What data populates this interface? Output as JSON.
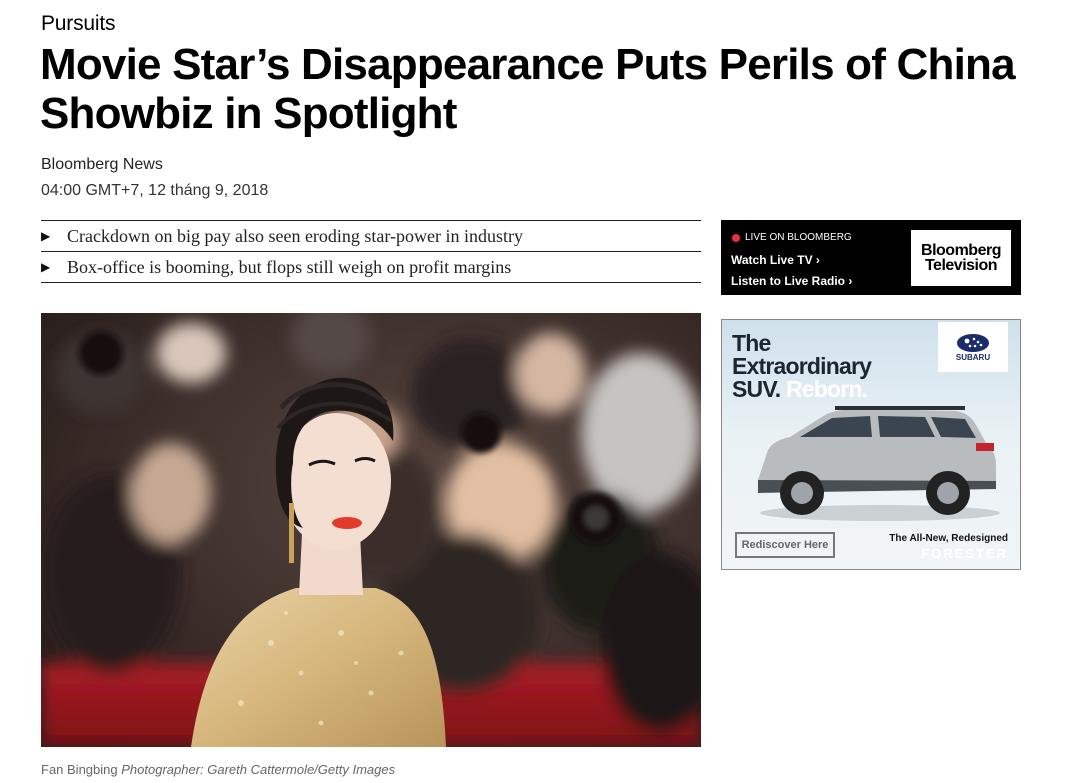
{
  "article": {
    "section": "Pursuits",
    "title": "Movie Star’s Disappearance Puts Perils of China Showbiz in Spotlight",
    "author": "Bloomberg News",
    "published": "04:00 GMT+7, 12 tháng 9, 2018",
    "summary": [
      "Crackdown on big pay also seen eroding star-power in industry",
      "Box-office is booming, but flops still weigh on profit margins"
    ],
    "caption": {
      "subject": "Fan Bingbing",
      "credit": "Photographer: Gareth Cattermole/Getty Images"
    }
  },
  "live_widget": {
    "status": "LIVE ON BLOOMBERG",
    "watch": "Watch Live TV",
    "listen": "Listen to Live Radio",
    "logo_line1": "Bloomberg",
    "logo_line2": "Television",
    "indicator_color": "#e8333a"
  },
  "ad": {
    "headline_line1": "The",
    "headline_line2": "Extraordinary",
    "headline_line3_a": "SUV.",
    "headline_line3_b": "Reborn.",
    "brand": "SUBARU",
    "cta": "Rediscover Here",
    "tagline": "The All-New, Redesigned",
    "model": "FORESTER"
  },
  "icons": {
    "summary_bullet": "triangle-right-icon",
    "live_dot": "live-dot-icon",
    "chevron": "chevron-right-icon"
  }
}
